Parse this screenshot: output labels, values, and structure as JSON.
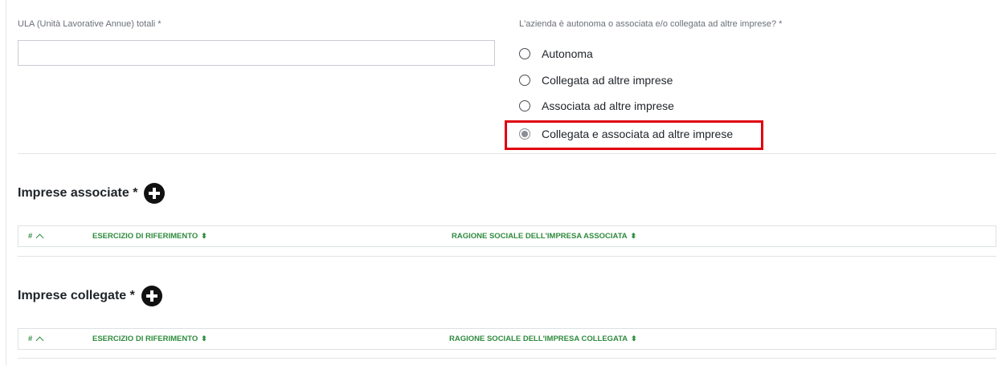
{
  "ula_field": {
    "label": "ULA (Unità Lavorative Annue) totali *",
    "value": "",
    "placeholder": ""
  },
  "azienda_question": {
    "label": "L'azienda è autonoma o associata e/o collegata ad altre imprese? *",
    "options": [
      {
        "label": "Autonoma",
        "checked": false
      },
      {
        "label": "Collegata ad altre imprese",
        "checked": false
      },
      {
        "label": "Associata ad altre imprese",
        "checked": false
      },
      {
        "label": "Collegata e associata ad altre imprese",
        "checked": true
      }
    ],
    "highlight_color": "#e1000f"
  },
  "sections": [
    {
      "title": "Imprese associate *",
      "columns": {
        "index": "#",
        "esercizio": "ESERCIZIO DI RIFERIMENTO",
        "ragione": "RAGIONE SOCIALE DELL'IMPRESA ASSOCIATA"
      }
    },
    {
      "title": "Imprese collegate *",
      "columns": {
        "index": "#",
        "esercizio": "ESERCIZIO DI RIFERIMENTO",
        "ragione": "RAGIONE SOCIALE DELL'IMPRESA COLLEGATA"
      }
    }
  ],
  "icons": {
    "add": "plus-circle-icon",
    "sort_asc": "chevron-up-icon",
    "sort": "sort-icon"
  },
  "colors": {
    "header_text": "#2e8b3d",
    "highlight": "#e1000f"
  }
}
